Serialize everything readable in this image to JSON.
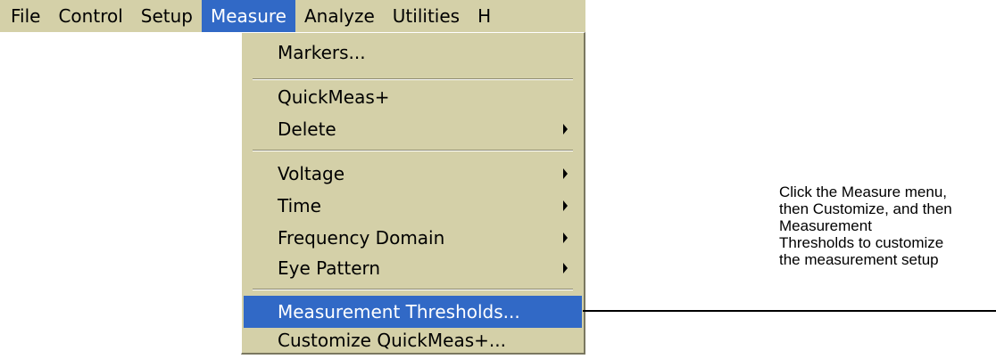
{
  "menubar": {
    "items": [
      {
        "label": "File"
      },
      {
        "label": "Control"
      },
      {
        "label": "Setup"
      },
      {
        "label": "Measure",
        "active": true
      },
      {
        "label": "Analyze"
      },
      {
        "label": "Utilities"
      },
      {
        "label": "H"
      }
    ]
  },
  "dropdown": {
    "items": [
      {
        "label": "Markers...",
        "submenu": false
      },
      {
        "label": "QuickMeas+",
        "submenu": false
      },
      {
        "label": "Delete",
        "submenu": true
      },
      {
        "label": "Voltage",
        "submenu": true
      },
      {
        "label": "Time",
        "submenu": true
      },
      {
        "label": "Frequency Domain",
        "submenu": true
      },
      {
        "label": "Eye Pattern",
        "submenu": true
      },
      {
        "label": "Measurement Thresholds...",
        "submenu": false,
        "highlighted": true
      },
      {
        "label": "Customize QuickMeas+...",
        "submenu": false
      }
    ]
  },
  "callout": {
    "lines": [
      "Click the Measure menu,",
      "then Customize, and then",
      "Measurement",
      "Thresholds to customize",
      "the measurement setup"
    ]
  },
  "colors": {
    "menu_bg": "#d4d0a8",
    "highlight": "#3169c6",
    "highlight_text": "#ffffff"
  }
}
